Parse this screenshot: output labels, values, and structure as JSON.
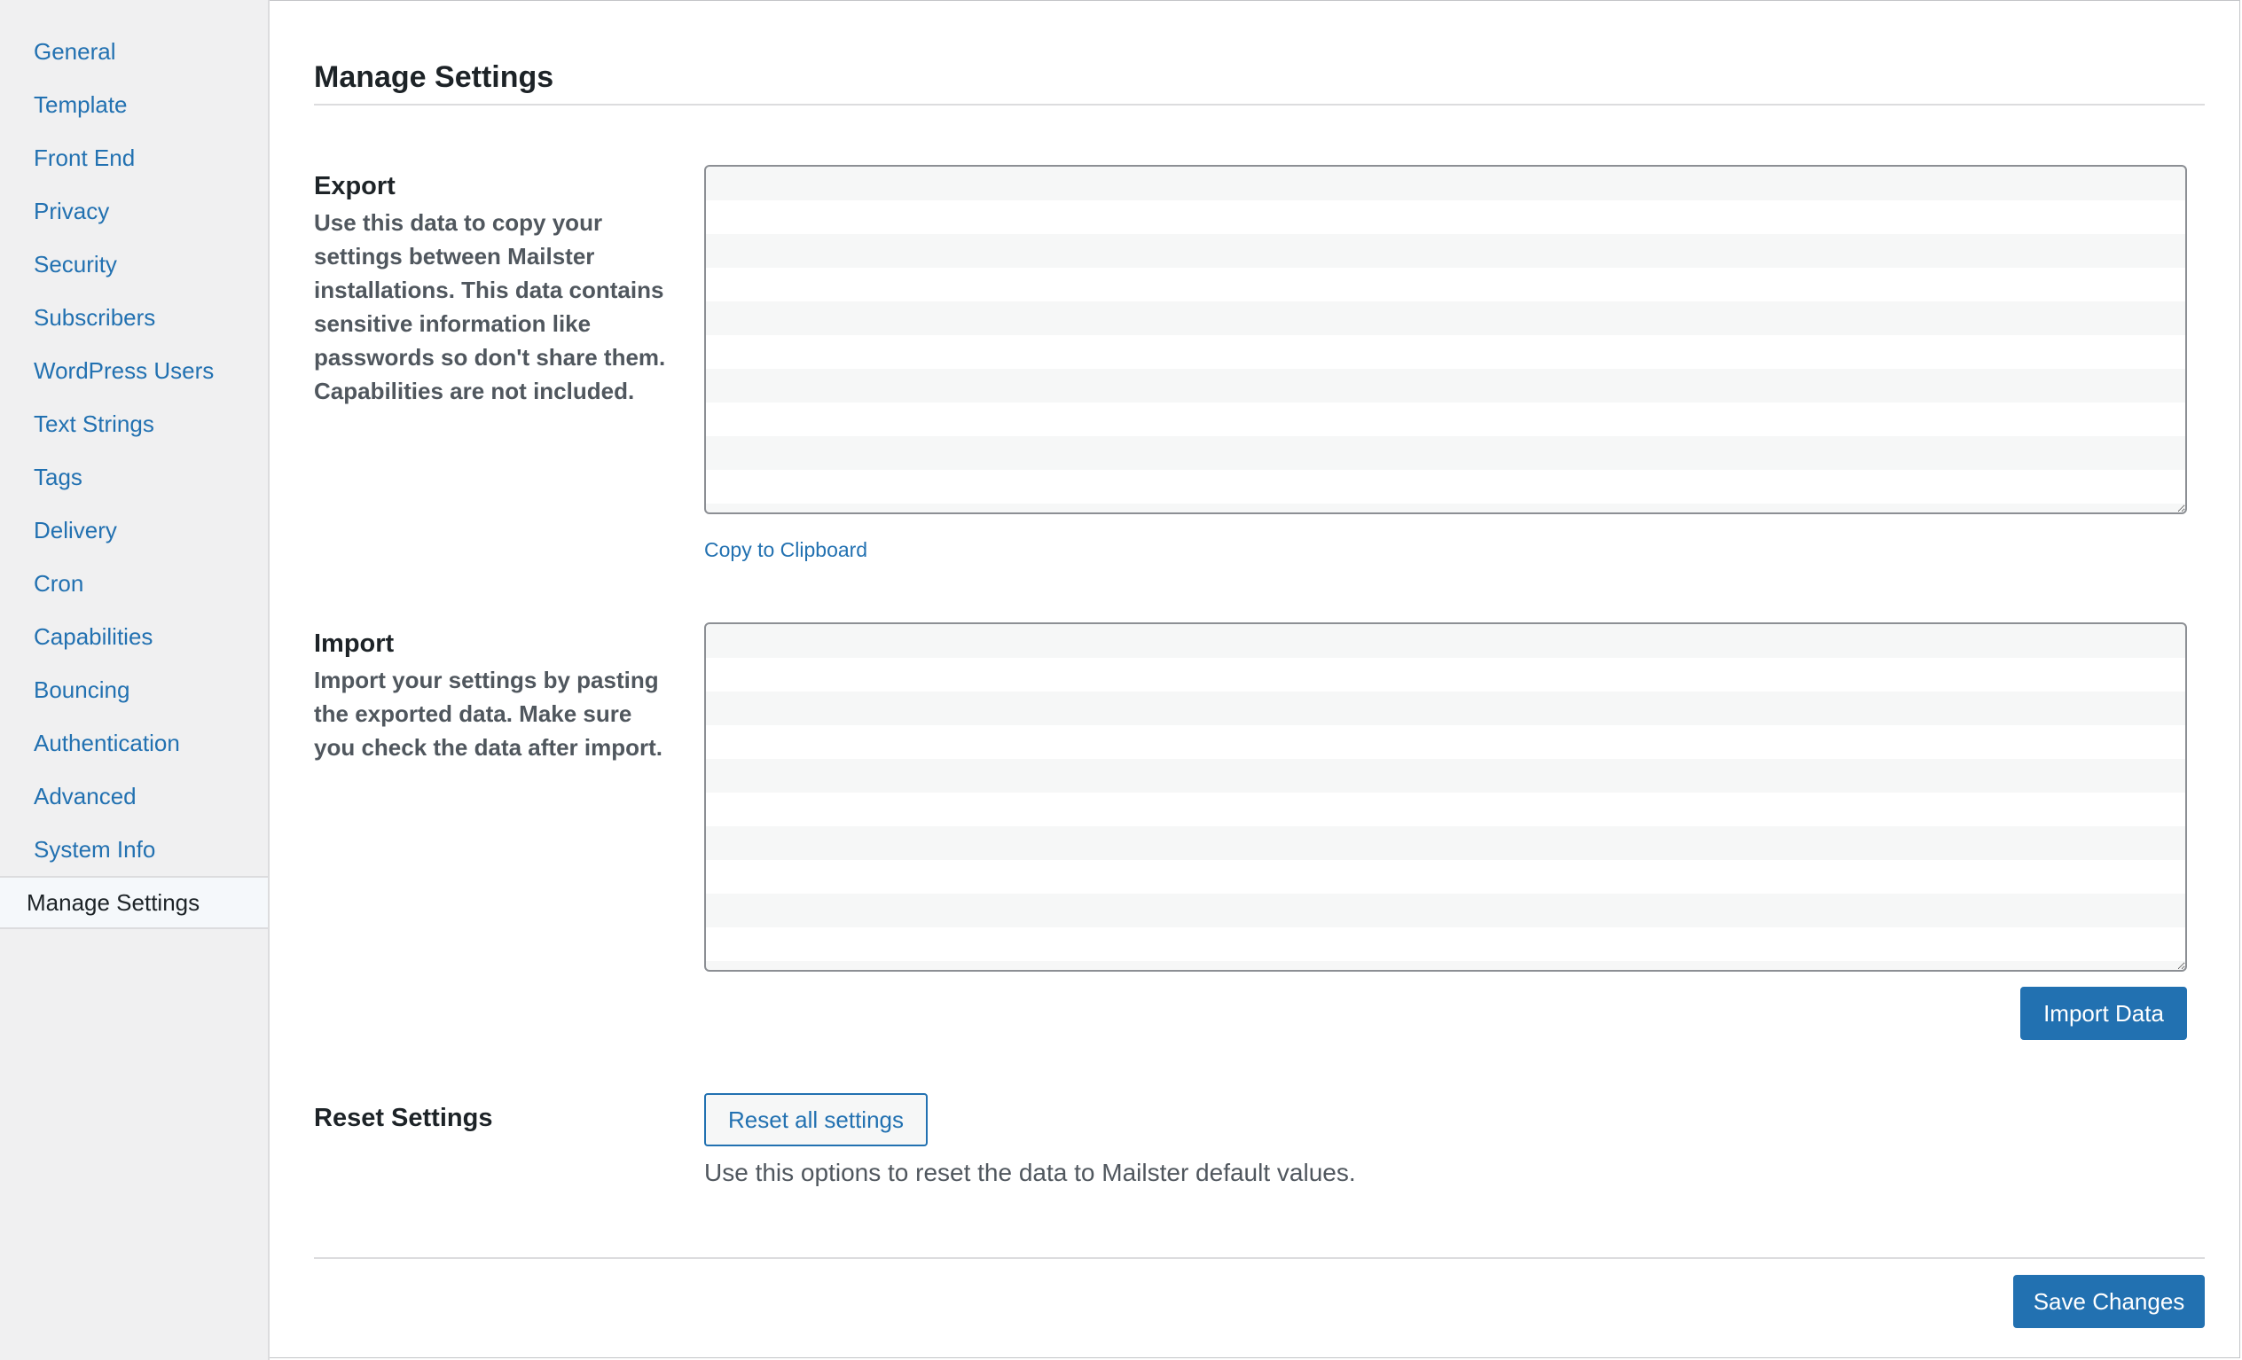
{
  "sidebar": {
    "items": [
      {
        "label": "General"
      },
      {
        "label": "Template"
      },
      {
        "label": "Front End"
      },
      {
        "label": "Privacy"
      },
      {
        "label": "Security"
      },
      {
        "label": "Subscribers"
      },
      {
        "label": "WordPress Users"
      },
      {
        "label": "Text Strings"
      },
      {
        "label": "Tags"
      },
      {
        "label": "Delivery"
      },
      {
        "label": "Cron"
      },
      {
        "label": "Capabilities"
      },
      {
        "label": "Bouncing"
      },
      {
        "label": "Authentication"
      },
      {
        "label": "Advanced"
      },
      {
        "label": "System Info"
      },
      {
        "label": "Manage Settings"
      }
    ],
    "active": "Manage Settings"
  },
  "main": {
    "title": "Manage Settings",
    "export": {
      "title": "Export",
      "description": "Use this data to copy your settings between Mailster installations. This data contains sensitive information like passwords so don't share them. Capabilities are not included.",
      "value": "",
      "copy_label": "Copy to Clipboard"
    },
    "import": {
      "title": "Import",
      "description": "Import your settings by pasting the exported data. Make sure you check the data after import.",
      "value": "",
      "button_label": "Import Data"
    },
    "reset": {
      "title": "Reset Settings",
      "button_label": "Reset all settings",
      "description": "Use this options to reset the data to Mailster default values."
    },
    "save_label": "Save Changes"
  },
  "colors": {
    "accent": "#2271b1",
    "sidebar_bg": "#f0f0f1",
    "text": "#1d2327",
    "muted_text": "#50575e"
  }
}
